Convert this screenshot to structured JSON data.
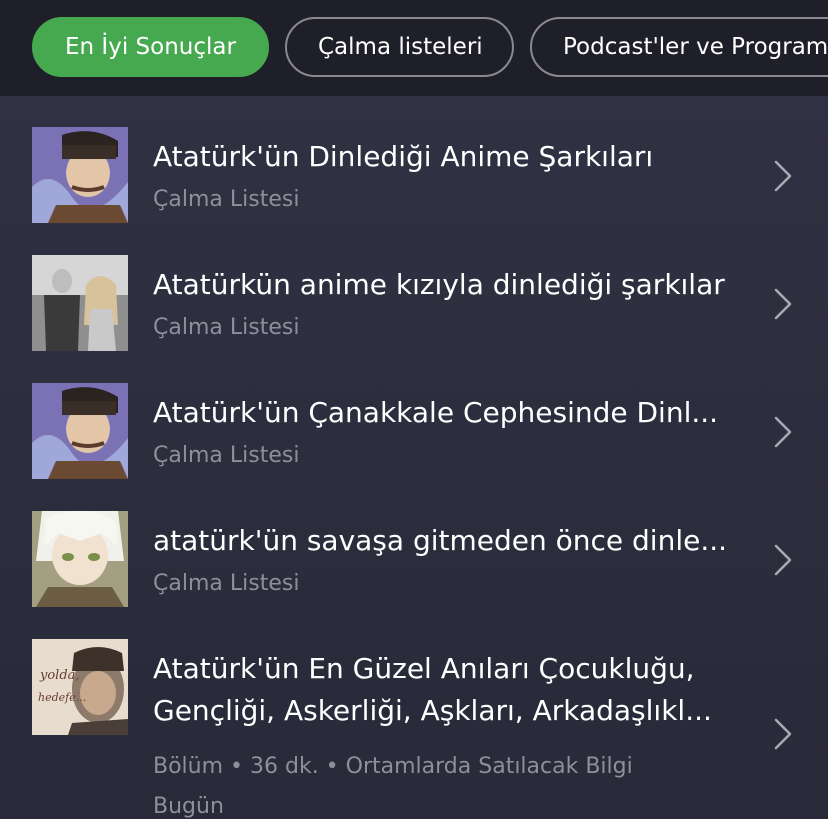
{
  "filters": [
    {
      "label": "En İyi Sonuçlar",
      "active": true
    },
    {
      "label": "Çalma listeleri",
      "active": false
    },
    {
      "label": "Podcast'ler ve Programlar",
      "active": false
    }
  ],
  "results": [
    {
      "title": "Atatürk'ün Dinlediği Anime Şarkıları",
      "subtitle": "Çalma Listesi"
    },
    {
      "title": "Atatürkün anime kızıyla dinlediği şarkılar",
      "subtitle": "Çalma Listesi"
    },
    {
      "title": "Atatürk'ün Çanakkale Cephesinde Dinl...",
      "subtitle": "Çalma Listesi"
    },
    {
      "title": "atatürk'ün savaşa gitmeden önce dinle...",
      "subtitle": "Çalma Listesi"
    },
    {
      "title_line1": "Atatürk'ün En Güzel Anıları Çocukluğu,",
      "title_line2": "Gençliği, Askerliği, Aşkları, Arkadaşlıkl...",
      "meta": "Bölüm • 36 dk. • Ortamlarda Satılacak Bilgi",
      "date": "Bugün",
      "thumb_text_1": "yolda,",
      "thumb_text_2": "hedefe..."
    }
  ]
}
